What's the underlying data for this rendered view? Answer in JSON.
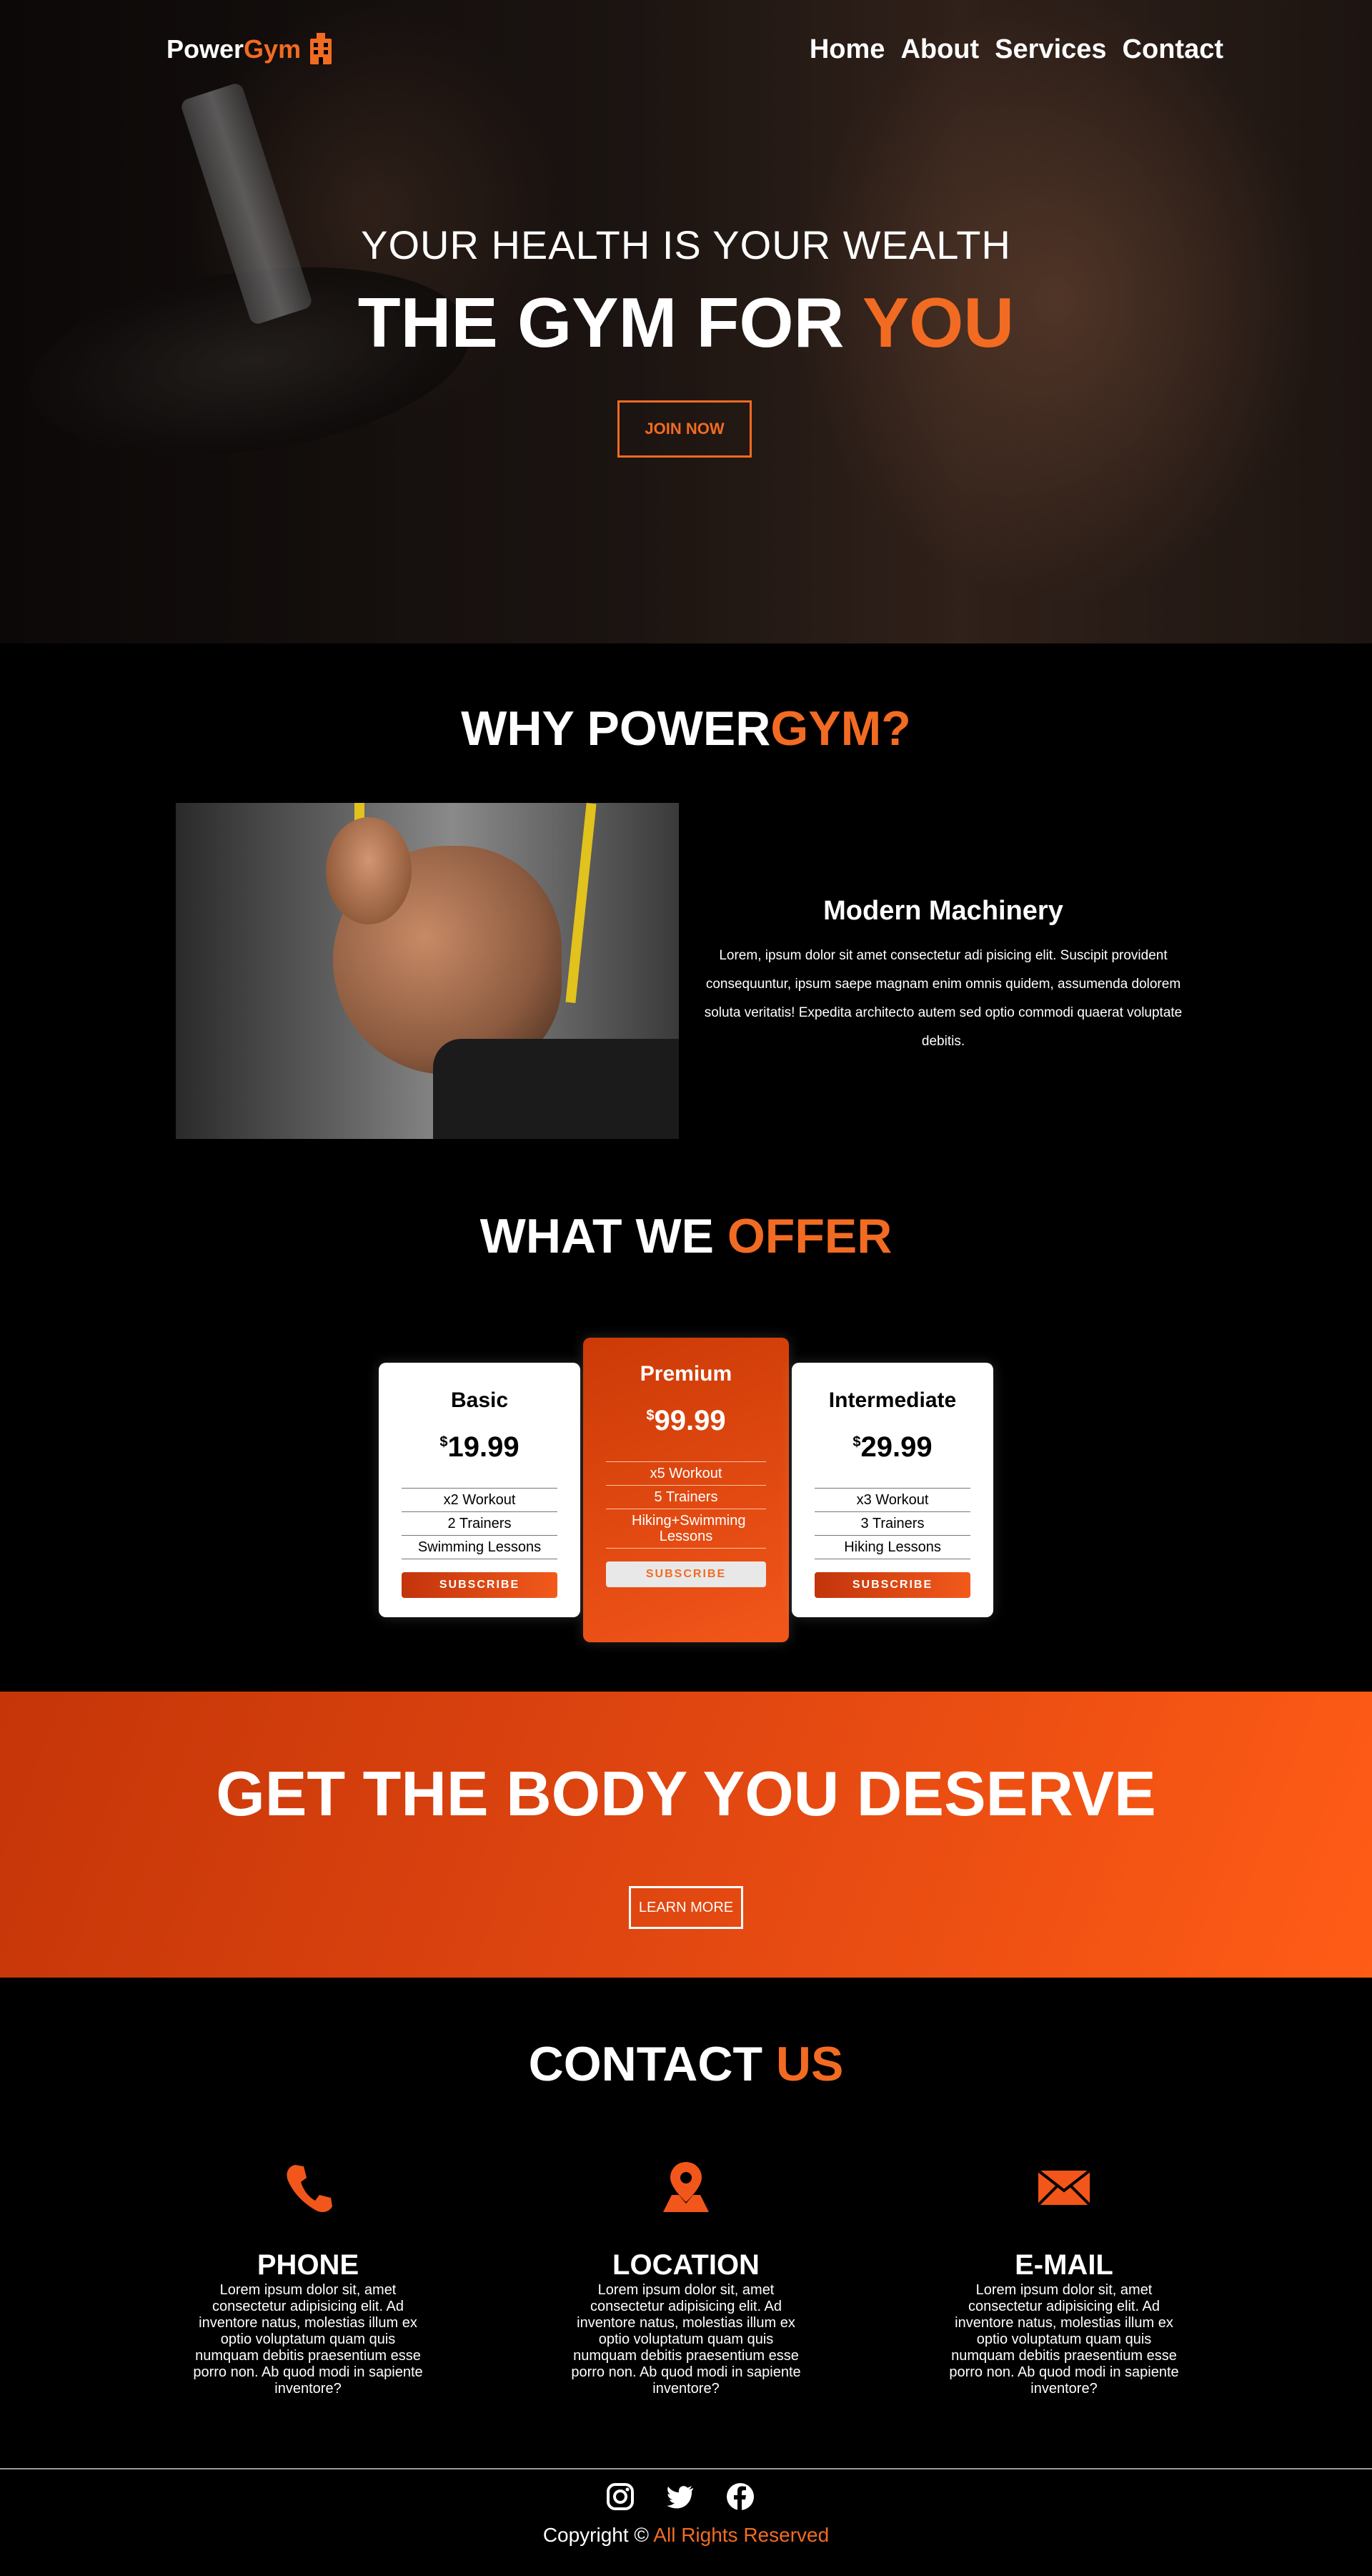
{
  "brand": {
    "name_part1": "Power ",
    "name_part2": "Gym",
    "accent": "#f26b22"
  },
  "nav": {
    "items": [
      "Home",
      "About",
      "Services",
      "Contact"
    ]
  },
  "hero": {
    "subtitle": "YOUR HEALTH IS YOUR WEALTH",
    "title_part1": "THE GYM FOR ",
    "title_part2": "YOU",
    "cta": "JOIN NOW"
  },
  "why": {
    "title_part1": "WHY POWER",
    "title_part2": "GYM?",
    "heading": "Modern Machinery",
    "text": "Lorem, ipsum dolor sit amet consectetur adi pisicing elit. Suscipit provident consequuntur, ipsum saepe magnam enim omnis quidem, assumenda dolorem soluta veritatis! Expedita architecto autem sed optio commodi quaerat voluptate debitis."
  },
  "offer": {
    "title_part1": "WHAT WE ",
    "title_part2": "OFFER",
    "plans": [
      {
        "name": "Basic",
        "currency": "$",
        "price": "19.99",
        "features": [
          "x2 Workout",
          "2 Trainers",
          "Swimming Lessons"
        ],
        "button": "SUBSCRIBE"
      },
      {
        "name": "Premium",
        "currency": "$",
        "price": "99.99",
        "features": [
          "x5 Workout",
          "5 Trainers",
          "Hiking+Swimming Lessons"
        ],
        "button": "SUBSCRIBE"
      },
      {
        "name": "Intermediate",
        "currency": "$",
        "price": "29.99",
        "features": [
          "x3 Workout",
          "3 Trainers",
          "Hiking Lessons"
        ],
        "button": "SUBSCRIBE"
      }
    ]
  },
  "cta": {
    "title": "GET THE BODY YOU DESERVE",
    "button": "LEARN MORE"
  },
  "contact": {
    "title_part1": "CONTACT ",
    "title_part2": "US",
    "items": [
      {
        "icon": "phone-icon",
        "heading": "PHONE",
        "text": "Lorem ipsum dolor sit, amet consectetur adipisicing elit. Ad inventore natus, molestias illum ex optio voluptatum quam quis numquam debitis praesentium esse porro non. Ab quod modi in sapiente inventore?"
      },
      {
        "icon": "location-icon",
        "heading": "LOCATION",
        "text": "Lorem ipsum dolor sit, amet consectetur adipisicing elit. Ad inventore natus, molestias illum ex optio voluptatum quam quis numquam debitis praesentium esse porro non. Ab quod modi in sapiente inventore?"
      },
      {
        "icon": "email-icon",
        "heading": "E-MAIL",
        "text": "Lorem ipsum dolor sit, amet consectetur adipisicing elit. Ad inventore natus, molestias illum ex optio voluptatum quam quis numquam debitis praesentium esse porro non. Ab quod modi in sapiente inventore?"
      }
    ]
  },
  "footer": {
    "socials": [
      "instagram-icon",
      "twitter-icon",
      "facebook-icon"
    ],
    "copyright_part1": "Copyright © ",
    "copyright_part2": "All Rights Reserved"
  }
}
